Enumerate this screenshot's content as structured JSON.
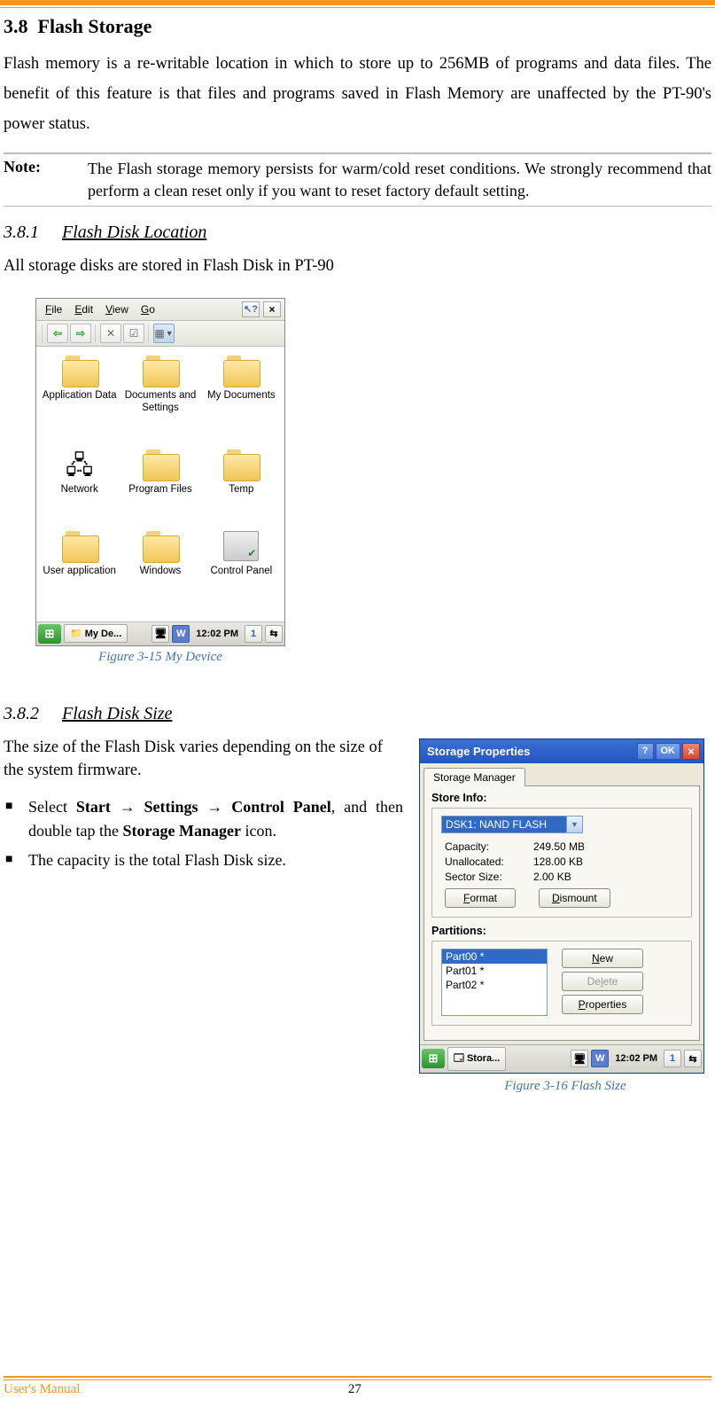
{
  "page": {
    "footer_left": "User's Manual",
    "page_number": "27"
  },
  "doc": {
    "section_no": "3.8",
    "section_title": "Flash Storage",
    "intro": "Flash memory is a re-writable location in which to store up to 256MB of programs and data files. The benefit of this feature is that files and programs saved in Flash Memory are unaffected by the PT-90's power status.",
    "note_label": "Note:",
    "note_text": "The Flash storage memory persists for warm/cold reset conditions. We strongly recommend that perform a clean reset only if you want to reset factory default setting.",
    "sub1_no": "3.8.1",
    "sub1_title": "Flash Disk Location",
    "sub1_text": "All storage disks are stored in Flash Disk in PT-90",
    "fig1_caption": "Figure 3-15 My Device",
    "sub2_no": "3.8.2",
    "sub2_title": "Flash Disk Size",
    "sub2_text": "The size of the Flash Disk varies depending on the size of the system firmware.",
    "bullet1_a": "Select ",
    "bullet1_b": "Start → Settings → Control Panel",
    "bullet1_c": ", and then double tap the ",
    "bullet1_d": "Storage Manager",
    "bullet1_e": " icon.",
    "bullet2": "The capacity is the total Flash Disk size.",
    "fig2_caption": "Figure 3-16 Flash Size"
  },
  "win1": {
    "menu": {
      "file": "File",
      "edit": "Edit",
      "view": "View",
      "go": "Go"
    },
    "help_label": "?",
    "items": [
      "Application Data",
      "Documents and Settings",
      "My Documents",
      "Network",
      "Program Files",
      "Temp",
      "User application",
      "Windows",
      "Control Panel"
    ],
    "task_label": "My De...",
    "clock": "12:02 PM",
    "tray_1": "1"
  },
  "win2": {
    "title": "Storage Properties",
    "ok": "OK",
    "tab": "Storage Manager",
    "store_label": "Store Info:",
    "combo": "DSK1: NAND FLASH",
    "capacity_k": "Capacity:",
    "capacity_v": "249.50 MB",
    "unalloc_k": "Unallocated:",
    "unalloc_v": "128.00 KB",
    "sector_k": "Sector Size:",
    "sector_v": "2.00 KB",
    "btn_format": "Format",
    "btn_dismount": "Dismount",
    "part_label": "Partitions:",
    "parts": [
      "Part00 *",
      "Part01 *",
      "Part02 *"
    ],
    "btn_new": "New",
    "btn_delete": "Delete",
    "btn_props": "Properties",
    "task_label": "Stora...",
    "clock": "12:02 PM",
    "tray_1": "1"
  }
}
